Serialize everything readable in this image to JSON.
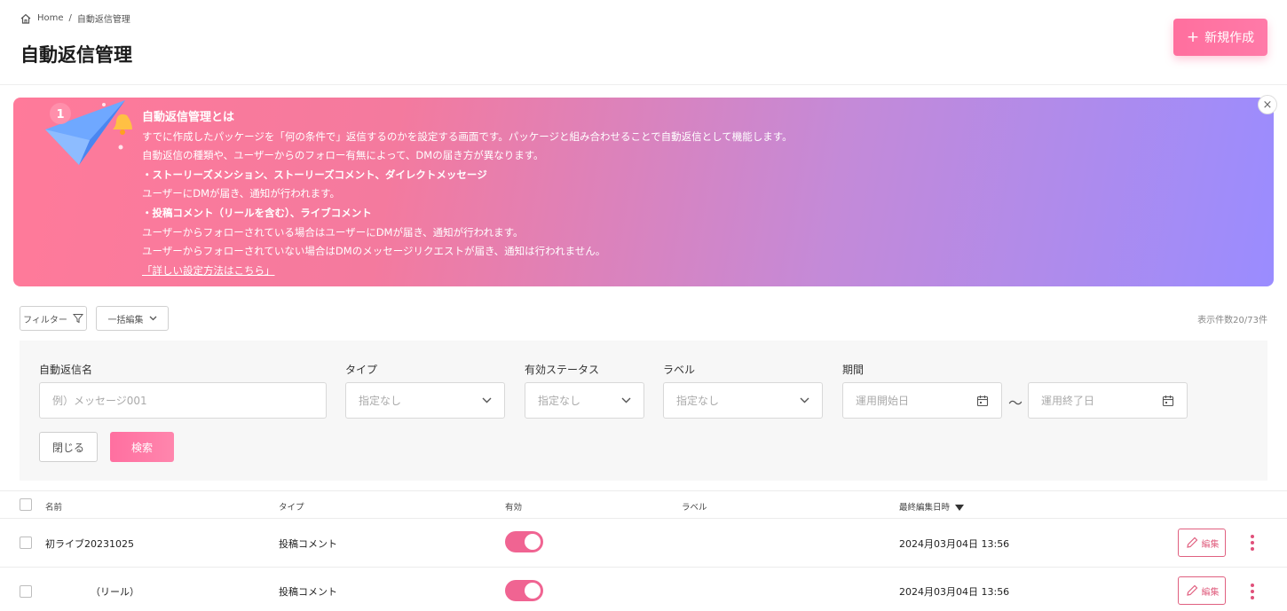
{
  "breadcrumb": {
    "home": "Home",
    "separator": "/",
    "current": "自動返信管理"
  },
  "page_title": "自動返信管理",
  "header": {
    "new_button": "新規作成",
    "plus": "+"
  },
  "banner": {
    "title": "自動返信管理とは",
    "lines": [
      "すでに作成したパッケージを「何の条件で」返信するのかを設定する画面です。パッケージと組み合わせることで自動返信として機能します。",
      "自動返信の種類や、ユーザーからのフォロー有無によって、DMの届き方が異なります。"
    ],
    "section1_title": "・ストーリーズメンション、ストーリーズコメント、ダイレクトメッセージ",
    "section1_text": "ユーザーにDMが届き、通知が行われます。",
    "section2_title": "・投稿コメント（リールを含む）、ライブコメント",
    "section2_lines": [
      "ユーザーからフォローされている場合はユーザーにDMが届き、通知が行われます。",
      "ユーザーからフォローされていない場合はDMのメッセージリクエストが届き、通知は行われません。"
    ],
    "link": "「詳しい設定方法はこちら」",
    "close": "×",
    "badge": "1"
  },
  "toolbar": {
    "filter": "フィルター",
    "bulk_edit": "一括編集",
    "count": "表示件数20/73件"
  },
  "filters": {
    "name_label": "自動返信名",
    "name_placeholder": "例）メッセージ001",
    "type_label": "タイプ",
    "type_value": "指定なし",
    "status_label": "有効ステータス",
    "status_value": "指定なし",
    "label_label": "ラベル",
    "label_value": "指定なし",
    "period_label": "期間",
    "start_placeholder": "運用開始日",
    "end_placeholder": "運用終了日",
    "tilde": "〜",
    "close_button": "閉じる",
    "search_button": "検索"
  },
  "table": {
    "headers": {
      "name": "名前",
      "type": "タイプ",
      "active": "有効",
      "label": "ラベル",
      "updated": "最終編集日時"
    },
    "rows": [
      {
        "name": "初ライブ20231025",
        "type": "投稿コメント",
        "active": true,
        "label": "",
        "updated": "2024月03月04日 13:56",
        "edit": "編集"
      },
      {
        "name": "（リール）",
        "type": "投稿コメント",
        "active": true,
        "label": "",
        "updated": "2024月03月04日 13:56",
        "edit": "編集"
      }
    ]
  },
  "colors": {
    "accent": "#f06492",
    "banner_start": "#ff7a9a",
    "banner_end": "#9a8cff"
  }
}
